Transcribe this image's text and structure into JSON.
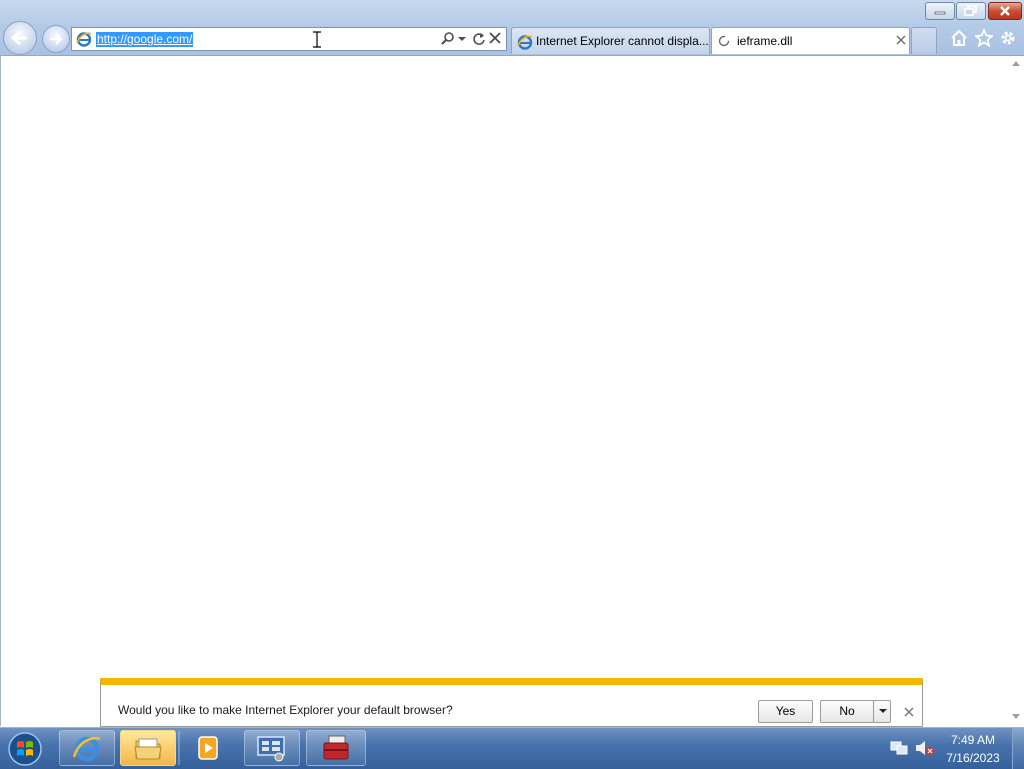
{
  "window": {
    "minimize_icon": "minimize-icon",
    "restore_icon": "restore-icon",
    "close_icon": "close-icon"
  },
  "navigation": {
    "back_icon": "back-arrow-icon",
    "forward_icon": "forward-arrow-icon"
  },
  "address_bar": {
    "value": "http://google.com/",
    "site_icon": "ie-logo-icon",
    "search_icon": "search-icon",
    "dropdown_icon": "chevron-down-icon",
    "refresh_icon": "refresh-icon",
    "stop_icon": "stop-icon"
  },
  "tabs": [
    {
      "label": "Internet Explorer cannot displa...",
      "icon": "ie-logo-icon",
      "active": false
    },
    {
      "label": "ieframe.dll",
      "icon": "loading-icon",
      "active": true
    }
  ],
  "command_bar": {
    "home_icon": "home-icon",
    "favorites_icon": "star-icon",
    "tools_icon": "gear-icon"
  },
  "notification": {
    "message": "Would you like to make Internet Explorer your default browser?",
    "yes_label": "Yes",
    "no_label": "No",
    "accent_color": "#f5b800"
  },
  "taskbar": {
    "items": [
      "start-orb-icon",
      "ie-logo-icon",
      "folder-icon",
      "media-player-icon",
      "server-manager-icon",
      "toolbox-icon"
    ],
    "tray_icons": [
      "network-icon",
      "volume-muted-icon"
    ],
    "clock_time": "7:49 AM",
    "clock_date": "7/16/2023"
  },
  "colors": {
    "selection": "#3399ff",
    "taskbar": "#4873ad",
    "close_button": "#c84f35"
  }
}
